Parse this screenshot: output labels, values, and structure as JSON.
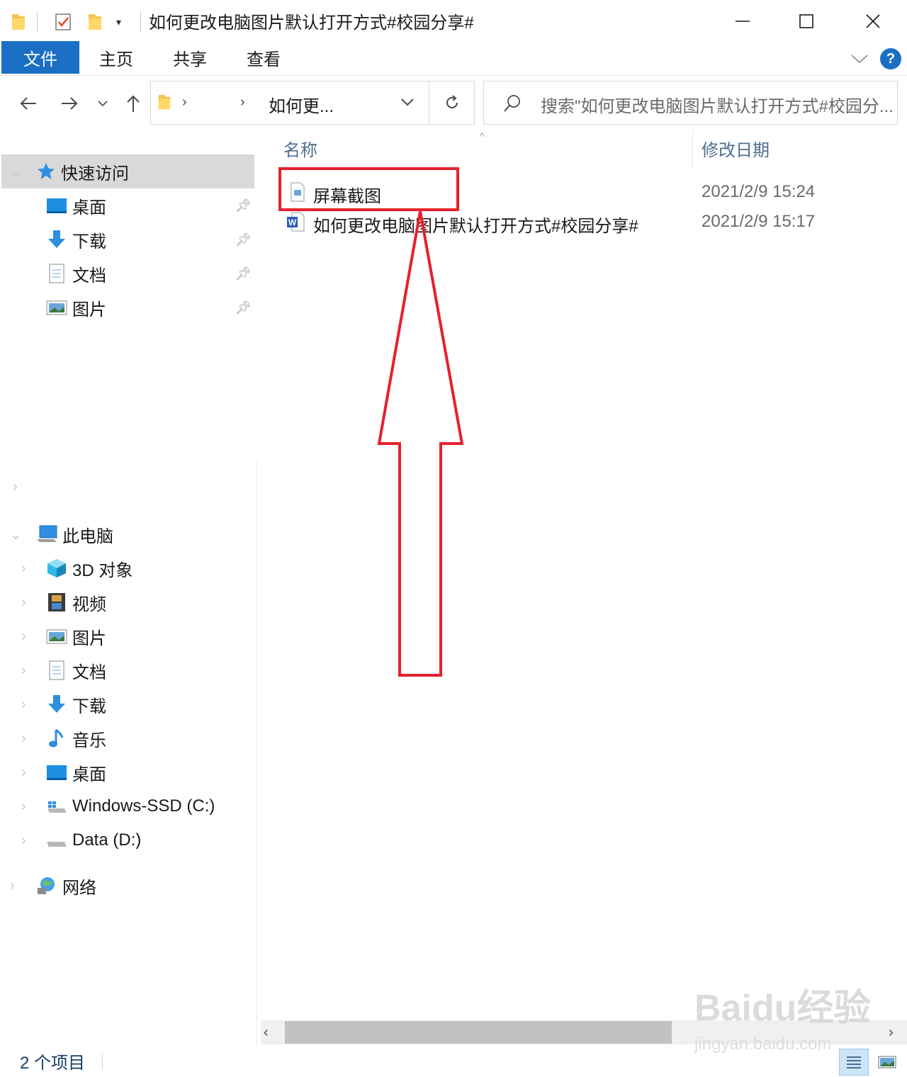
{
  "window": {
    "title": "如何更改电脑图片默认打开方式#校园分享#"
  },
  "ribbon": {
    "tabs": [
      "文件",
      "主页",
      "共享",
      "查看"
    ]
  },
  "nav": {
    "address_current": "如何更...",
    "search_placeholder": "搜索\"如何更改电脑图片默认打开方式#校园分..."
  },
  "sidebar": {
    "quick_access": {
      "label": "快速访问",
      "items": [
        {
          "label": "桌面",
          "icon": "desktop-icon"
        },
        {
          "label": "下载",
          "icon": "download-icon"
        },
        {
          "label": "文档",
          "icon": "document-icon"
        },
        {
          "label": "图片",
          "icon": "pictures-icon"
        }
      ]
    },
    "this_pc": {
      "label": "此电脑",
      "items": [
        {
          "label": "3D 对象",
          "icon": "3d-objects-icon"
        },
        {
          "label": "视频",
          "icon": "video-icon"
        },
        {
          "label": "图片",
          "icon": "pictures-icon"
        },
        {
          "label": "文档",
          "icon": "document-icon"
        },
        {
          "label": "下载",
          "icon": "download-icon"
        },
        {
          "label": "音乐",
          "icon": "music-icon"
        },
        {
          "label": "桌面",
          "icon": "desktop-icon"
        },
        {
          "label": "Windows-SSD (C:)",
          "icon": "windows-drive-icon"
        },
        {
          "label": "Data (D:)",
          "icon": "drive-icon"
        }
      ]
    },
    "network": {
      "label": "网络"
    }
  },
  "files": {
    "columns": [
      "名称",
      "修改日期"
    ],
    "rows": [
      {
        "name": "屏幕截图",
        "modified": "2021/2/9 15:24",
        "icon": "image-file-icon"
      },
      {
        "name": "如何更改电脑图片默认打开方式#校园分享#",
        "modified": "2021/2/9 15:17",
        "icon": "word-file-icon"
      }
    ]
  },
  "status": {
    "item_count": "2 个项目"
  },
  "watermark": {
    "brand": "Baidu经验",
    "url": "jingyan.baidu.com"
  },
  "colors": {
    "accent": "#1a6fc4",
    "annotation": "#e5222d",
    "selected_bg": "#d9d9d9"
  }
}
